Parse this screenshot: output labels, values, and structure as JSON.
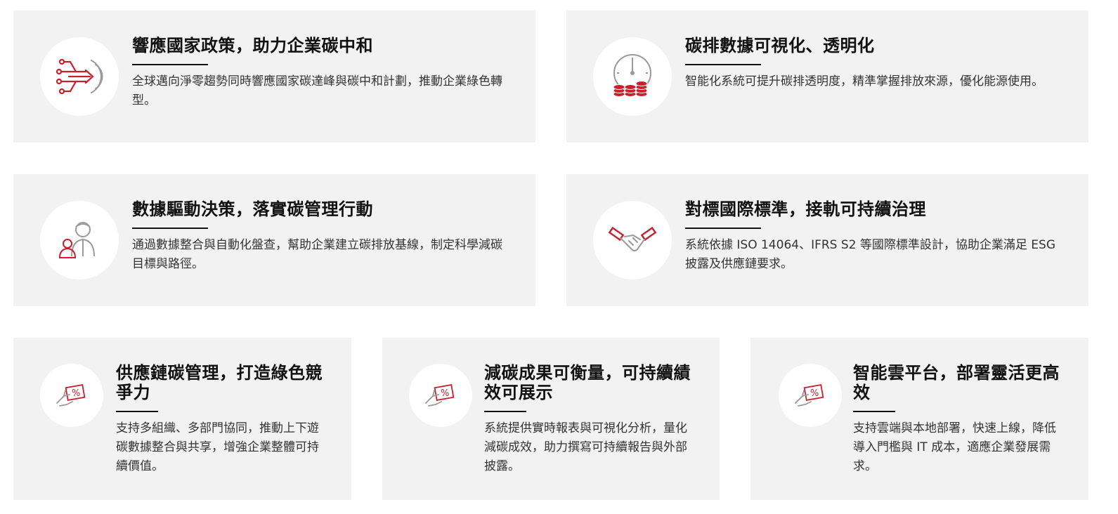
{
  "colors": {
    "card_background": "#f2f2f2",
    "icon_background": "#ffffff",
    "accent_red": "#c8202c",
    "icon_gray": "#9a9a9a",
    "title": "#111111",
    "text": "#333333"
  },
  "cards": [
    {
      "icon": "digital-transform-arrow-icon",
      "title": "響應國家政策，助力企業碳中和",
      "description": "全球邁向淨零趨勢同時響應國家碳達峰與碳中和計劃，推動企業綠色轉型。"
    },
    {
      "icon": "clock-coins-icon",
      "title": "碳排數據可視化、透明化",
      "description": "智能化系統可提升碳排透明度，精準掌握排放來源，優化能源使用。"
    },
    {
      "icon": "people-manager-icon",
      "title": "數據驅動決策，落實碳管理行動",
      "description": "通過數據整合與自動化盤查，幫助企業建立碳排放基線，制定科學減碳目標與路徑。"
    },
    {
      "icon": "handshake-icon",
      "title": "對標國際標準，接軌可持續治理",
      "description": "系統依據 ISO 14064、IFRS S2 等國際標準設計，協助企業滿足 ESG 披露及供應鏈要求。"
    },
    {
      "icon": "percent-card-hand-icon",
      "title": "供應鏈碳管理，打造綠色競爭力",
      "description": "支持多組織、多部門協同，推動上下遊碳數據整合與共享，增強企業整體可持續價值。"
    },
    {
      "icon": "percent-card-hand-icon",
      "title": "減碳成果可衡量，可持續績效可展示",
      "description": "系統提供實時報表與可視化分析，量化減碳成效，助力撰寫可持續報告與外部披露。"
    },
    {
      "icon": "percent-card-hand-icon",
      "title": "智能雲平台，部署靈活更高效",
      "description": "支持雲端與本地部署，快速上線，降低導入門檻與 IT 成本，適應企業發展需求。"
    }
  ]
}
